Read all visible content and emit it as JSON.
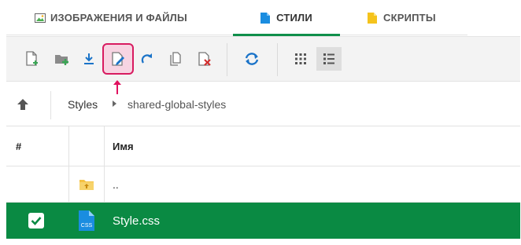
{
  "tabs": [
    {
      "label": "ИЗОБРАЖЕНИЯ И ФАЙЛЫ",
      "icon": "image-icon",
      "active": false
    },
    {
      "label": "СТИЛИ",
      "icon": "css-file-icon",
      "active": true
    },
    {
      "label": "СКРИПТЫ",
      "icon": "js-file-icon",
      "active": false
    }
  ],
  "toolbar": {
    "buttons": [
      {
        "name": "new-file-button",
        "icon": "new-file-icon"
      },
      {
        "name": "new-folder-button",
        "icon": "new-folder-icon"
      },
      {
        "name": "download-button",
        "icon": "download-icon"
      },
      {
        "name": "edit-file-button",
        "icon": "edit-file-icon",
        "highlighted": true
      },
      {
        "name": "redo-button",
        "icon": "redo-icon"
      },
      {
        "name": "copy-button",
        "icon": "copy-icon"
      },
      {
        "name": "delete-button",
        "icon": "delete-file-icon"
      },
      {
        "name": "refresh-button",
        "icon": "refresh-icon"
      },
      {
        "name": "grid-view-button",
        "icon": "grid-view-icon"
      },
      {
        "name": "list-view-button",
        "icon": "list-view-icon",
        "selected": true
      }
    ]
  },
  "breadcrumb": {
    "root": "Styles",
    "current": "shared-global-styles"
  },
  "table": {
    "headers": {
      "num": "#",
      "name": "Имя"
    },
    "rows": [
      {
        "type": "parent-folder",
        "name": ".."
      },
      {
        "type": "css-file",
        "name": "Style.css",
        "file_icon_text": "CSS",
        "selected": true,
        "checked": true
      }
    ]
  },
  "colors": {
    "accent_green": "#0a8a43",
    "tab_active_underline": "#0f8f4a",
    "highlight_border": "#d81b60",
    "highlight_fill": "#f7d4e2",
    "icon_blue": "#1a73c8",
    "folder_yellow": "#f5c242"
  }
}
